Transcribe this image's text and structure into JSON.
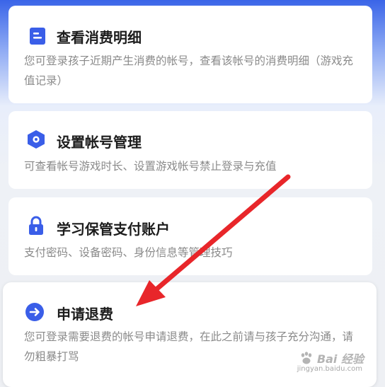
{
  "items": [
    {
      "title": "查看消费明细",
      "desc": "您可登录孩子近期产生消费的帐号，查看该帐号的消费明细（游戏充值记录）",
      "icon": "document-icon",
      "icon_color": "#3a5ee8"
    },
    {
      "title": "设置帐号管理",
      "desc": "可查看帐号游戏时长、设置游戏帐号禁止登录与充值",
      "icon": "hexagon-settings-icon",
      "icon_color": "#3a5ee8"
    },
    {
      "title": "学习保管支付账户",
      "desc": "支付密码、设备密码、身份信息等管理技巧",
      "icon": "lock-icon",
      "icon_color": "#3a5ee8"
    },
    {
      "title": "申请退费",
      "desc": "您可登录需要退费的帐号申请退费，在此之前请与孩子充分沟通，请勿粗暴打骂",
      "icon": "arrow-right-circle-icon",
      "icon_color": "#3a5ee8"
    }
  ],
  "annotation": {
    "color": "#e8262a"
  },
  "watermark": {
    "text": "Bai 经验",
    "sub": "jingyan.baidu.com"
  }
}
